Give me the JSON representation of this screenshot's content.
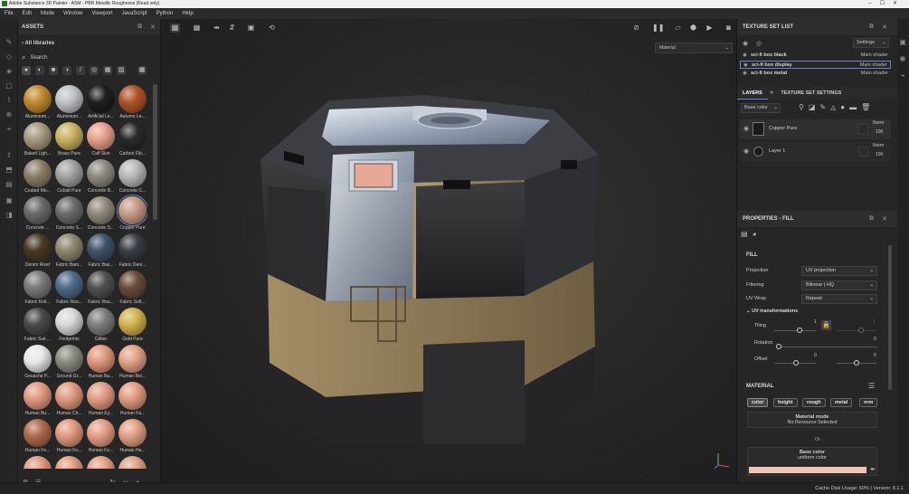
{
  "app": {
    "title": "Adobe Substance 3D Painter - ASM - PBR Metallic Roughness (Read only)"
  },
  "menu": [
    "File",
    "Edit",
    "Mode",
    "Window",
    "Viewport",
    "JavaScript",
    "Python",
    "Help"
  ],
  "assets": {
    "title": "ASSETS",
    "library": "All libraries",
    "search_placeholder": "Search",
    "items": [
      {
        "label": "Aluminium...",
        "color": "#c28a2c"
      },
      {
        "label": "Aluminium...",
        "color": "#bfc2c6"
      },
      {
        "label": "Artificial Le...",
        "color": "#1e1e1e"
      },
      {
        "label": "Autumn Le...",
        "color": "#b0532a"
      },
      {
        "label": "Baked Ligh...",
        "color": "#a79a80"
      },
      {
        "label": "Brass Pure",
        "color": "#c9b25e"
      },
      {
        "label": "Calf Skin",
        "color": "#e6a08a"
      },
      {
        "label": "Carbon Fib...",
        "color": "#2a2a2a"
      },
      {
        "label": "Coated Me...",
        "color": "#8a7e66"
      },
      {
        "label": "Cobalt Pure",
        "color": "#a2a2a2"
      },
      {
        "label": "Concrete B...",
        "color": "#8d8a82"
      },
      {
        "label": "Concrete C...",
        "color": "#b8b8b8"
      },
      {
        "label": "Concrete ...",
        "color": "#6a6a6a"
      },
      {
        "label": "Concrete S...",
        "color": "#6b6b6b"
      },
      {
        "label": "Concrete S...",
        "color": "#8f887c"
      },
      {
        "label": "Copper Pure",
        "color": "#c89a86"
      },
      {
        "label": "Denim Rivet",
        "color": "#4a3a24"
      },
      {
        "label": "Fabric Bam...",
        "color": "#8d8770"
      },
      {
        "label": "Fabric Bas...",
        "color": "#3e5468"
      },
      {
        "label": "Fabric Deni...",
        "color": "#3a3e46"
      },
      {
        "label": "Fabric Knit...",
        "color": "#7a7a7a"
      },
      {
        "label": "Fabric Rou...",
        "color": "#4c6a86"
      },
      {
        "label": "Fabric Rou...",
        "color": "#505050"
      },
      {
        "label": "Fabric Soft...",
        "color": "#6a4c3a"
      },
      {
        "label": "Fabric Suit ...",
        "color": "#4a4a4a"
      },
      {
        "label": "Footprints",
        "color": "#d8d8d8"
      },
      {
        "label": "Glitter",
        "color": "#7c7c7c"
      },
      {
        "label": "Gold Pure",
        "color": "#d4b24a"
      },
      {
        "label": "Gouache P...",
        "color": "#e8e8e8"
      },
      {
        "label": "Ground Gr...",
        "color": "#8a8a80"
      },
      {
        "label": "Human Ba...",
        "color": "#e0987c"
      },
      {
        "label": "Human Bel...",
        "color": "#e2a286"
      },
      {
        "label": "Human Bu...",
        "color": "#e29a80"
      },
      {
        "label": "Human Ch...",
        "color": "#e09a7e"
      },
      {
        "label": "Human Ey...",
        "color": "#e49c82"
      },
      {
        "label": "Human Fa...",
        "color": "#e29c80"
      },
      {
        "label": "Human Fe...",
        "color": "#b06a4a"
      },
      {
        "label": "Human Fo...",
        "color": "#e29a7e"
      },
      {
        "label": "Human Fo...",
        "color": "#e49e84"
      },
      {
        "label": "Human He...",
        "color": "#e2a084"
      },
      {
        "label": "",
        "color": "#e09a7e"
      },
      {
        "label": "",
        "color": "#e29c80"
      },
      {
        "label": "",
        "color": "#e49e82"
      },
      {
        "label": "",
        "color": "#e2a084"
      }
    ]
  },
  "viewport": {
    "material_mode": "Material"
  },
  "texture_sets": {
    "title": "TEXTURE SET LIST",
    "settings": "Settings",
    "items": [
      {
        "name": "sci-fi box black",
        "shader": "Main shader"
      },
      {
        "name": "sci-fi box display",
        "shader": "Main shader"
      },
      {
        "name": "sci-fi box metal",
        "shader": "Main shader"
      }
    ]
  },
  "layers": {
    "tab_layers": "LAYERS",
    "tab_settings": "TEXTURE SET SETTINGS",
    "channel": "Base color",
    "items": [
      {
        "name": "Copper Pure",
        "blend": "Norm",
        "opacity": "100"
      },
      {
        "name": "Layer 1",
        "blend": "Norm",
        "opacity": "100"
      }
    ]
  },
  "properties": {
    "title": "PROPERTIES - FILL",
    "fill_title": "FILL",
    "projection_label": "Projection",
    "projection_value": "UV projection",
    "filtering_label": "Filtering",
    "filtering_value": "Bilinear | HQ",
    "uvwrap_label": "UV Wrap",
    "uvwrap_value": "Repeat",
    "uvt_title": "UV transformations",
    "tiling_label": "Tiling",
    "tiling_value": "1",
    "tiling_value2": "1",
    "rotation_label": "Rotation",
    "rotation_value": "0",
    "offset_label": "Offset",
    "offset_value1": "0",
    "offset_value2": "0",
    "material_title": "MATERIAL",
    "channels": [
      "color",
      "height",
      "rough",
      "metal",
      "nrm"
    ],
    "material_mode_label": "Material mode",
    "material_mode_value": "No Resource Selected",
    "or": "Or",
    "base_color_label": "Base color",
    "base_color_value": "uniform color",
    "base_color_swatch": "#f2c4b4"
  },
  "status": "Cache Disk Usage:   60%  |  Version: 8.1.1"
}
